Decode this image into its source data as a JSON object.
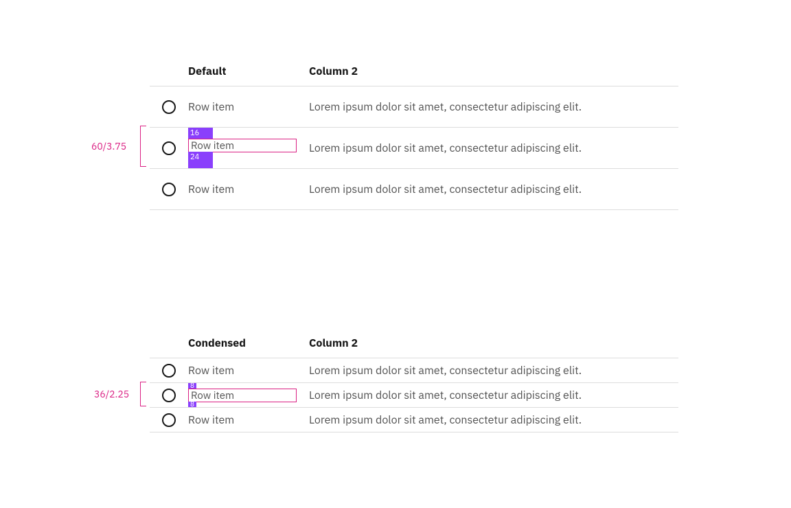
{
  "accent_color": "#8a3ffc",
  "spec_color": "#da1e82",
  "default_table": {
    "headers": {
      "col1": "Default",
      "col2": "Column 2"
    },
    "rows": [
      {
        "item": "Row item",
        "desc": "Lorem ipsum dolor sit amet, consectetur adipiscing elit."
      },
      {
        "item": "Row item",
        "desc": "Lorem ipsum dolor sit amet, consectetur adipiscing elit."
      },
      {
        "item": "Row item",
        "desc": "Lorem ipsum dolor sit amet, consectetur adipiscing elit."
      }
    ],
    "spec": {
      "row_height_label": "60/3.75",
      "padding_top": "16",
      "padding_bottom": "24"
    }
  },
  "condensed_table": {
    "headers": {
      "col1": "Condensed",
      "col2": "Column 2"
    },
    "rows": [
      {
        "item": "Row item",
        "desc": "Lorem ipsum dolor sit amet, consectetur adipiscing elit."
      },
      {
        "item": "Row item",
        "desc": "Lorem ipsum dolor sit amet, consectetur adipiscing elit."
      },
      {
        "item": "Row item",
        "desc": "Lorem ipsum dolor sit amet, consectetur adipiscing elit."
      }
    ],
    "spec": {
      "row_height_label": "36/2.25",
      "padding_top": "8",
      "padding_bottom": "8"
    }
  }
}
